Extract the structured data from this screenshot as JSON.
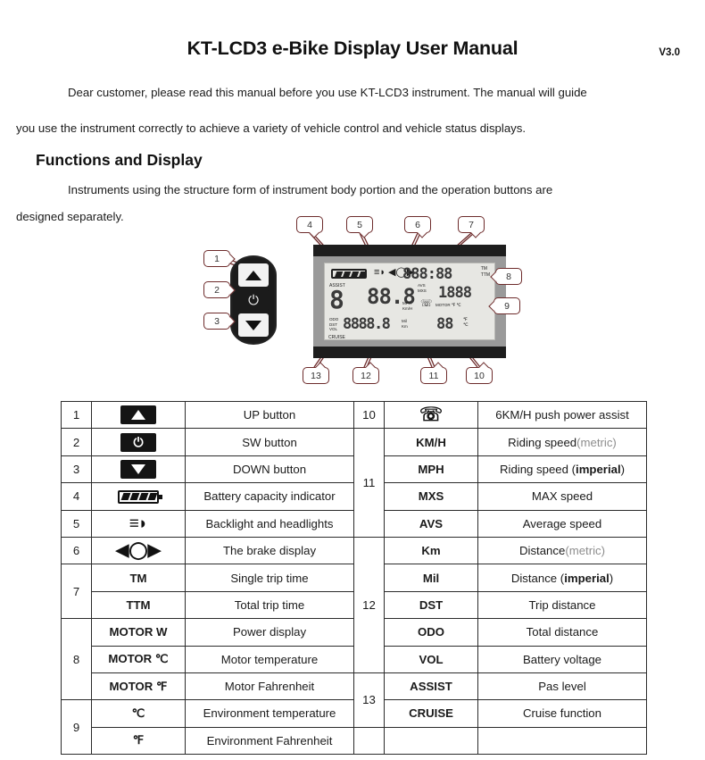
{
  "document": {
    "title": "KT-LCD3 e-Bike Display User Manual",
    "version": "V3.0",
    "intro_paragraph_1": "Dear customer, please read this manual before you use KT-LCD3 instrument. The manual will guide",
    "intro_paragraph_2": "you use the instrument correctly to achieve a variety of vehicle control and vehicle status displays.",
    "section_heading": "Functions and Display",
    "section_paragraph_1": "Instruments using the structure form of instrument body portion and the operation buttons are",
    "section_paragraph_2": "designed separately."
  },
  "diagram": {
    "callouts": [
      "1",
      "2",
      "3",
      "4",
      "5",
      "6",
      "7",
      "8",
      "9",
      "10",
      "11",
      "12",
      "13"
    ],
    "keypad": {
      "up_icon": "triangle-up-icon",
      "power_icon": "power-icon",
      "power_glyph": "⏻",
      "down_icon": "triangle-down-icon"
    },
    "lcd": {
      "battery_icon": "battery-icon",
      "headlight_glyph": "≡◗",
      "brake_glyph": "◀◯▶",
      "clock_value": "888:88",
      "tm_label": "TM",
      "ttm_label": "TTM",
      "assist_label": "ASSIST",
      "assist_value": "8",
      "cruise_label": "CRUISE",
      "speed_value": "88.8",
      "speed_unit_1": "MPH",
      "speed_unit_2": "Km/H",
      "avs_label": "AVS",
      "mxs_label": "MXS",
      "walk_glyph": "Ὣ6",
      "motor_value": "1888",
      "motor_label": "MOTOR ℉ ℃",
      "odo_label_1": "ODO",
      "odo_label_2": "DST",
      "odo_label_3": "VOL",
      "dst_value": "8888.8",
      "dst_unit_1": "Mil",
      "dst_unit_2": "Km",
      "temp_value": "88",
      "temp_unit_1": "℉",
      "temp_unit_2": "℃"
    }
  },
  "legend_table": {
    "left_rows": [
      {
        "num": "1",
        "sym_type": "icon",
        "sym_icon": "up-button-icon",
        "sym": "",
        "desc": "UP button"
      },
      {
        "num": "2",
        "sym_type": "icon",
        "sym_icon": "sw-button-icon",
        "sym": "",
        "desc": "SW button"
      },
      {
        "num": "3",
        "sym_type": "icon",
        "sym_icon": "down-button-icon",
        "sym": "",
        "desc": "DOWN button"
      },
      {
        "num": "4",
        "sym_type": "icon",
        "sym_icon": "battery-icon",
        "sym": "",
        "desc": "Battery capacity indicator"
      },
      {
        "num": "5",
        "sym_type": "icon",
        "sym_icon": "headlight-icon",
        "sym": "",
        "desc": "Backlight and headlights"
      },
      {
        "num": "6",
        "sym_type": "icon",
        "sym_icon": "brake-icon",
        "sym": "",
        "desc": "The brake display"
      },
      {
        "num": "7",
        "sym_type": "text",
        "sym_icon": "",
        "sym": "TM",
        "desc": "Single trip time",
        "rowspan": 2
      },
      {
        "num": "",
        "sym_type": "text",
        "sym_icon": "",
        "sym": "TTM",
        "desc": "Total trip time"
      },
      {
        "num": "8",
        "sym_type": "text",
        "sym_icon": "",
        "sym": "MOTOR W",
        "desc": "Power display",
        "rowspan": 3
      },
      {
        "num": "",
        "sym_type": "text",
        "sym_icon": "",
        "sym": "MOTOR ℃",
        "desc": "Motor temperature"
      },
      {
        "num": "",
        "sym_type": "text",
        "sym_icon": "",
        "sym": "MOTOR ℉",
        "desc": "Motor Fahrenheit"
      },
      {
        "num": "9",
        "sym_type": "text",
        "sym_icon": "",
        "sym": "℃",
        "desc": "Environment temperature",
        "rowspan": 2
      },
      {
        "num": "",
        "sym_type": "text",
        "sym_icon": "",
        "sym": "℉",
        "desc": "Environment Fahrenheit"
      }
    ],
    "right_rows": [
      {
        "num": "10",
        "sym_type": "icon",
        "sym_icon": "walking-person-icon",
        "sym": "",
        "desc": "6KM/H push power assist"
      },
      {
        "num": "11",
        "sym_type": "text",
        "sym_icon": "",
        "sym": "KM/H",
        "desc_html": "Riding speed<span class='grey'>(metric)</span>",
        "rowspan": 4
      },
      {
        "num": "",
        "sym_type": "text",
        "sym_icon": "",
        "sym": "MPH",
        "desc_html": "Riding speed (<span class='bold'>imperial</span>)"
      },
      {
        "num": "",
        "sym_type": "text",
        "sym_icon": "",
        "sym": "MXS",
        "desc_html": "MAX speed"
      },
      {
        "num": "",
        "sym_type": "text",
        "sym_icon": "",
        "sym": "AVS",
        "desc_html": "Average speed"
      },
      {
        "num": "12",
        "sym_type": "text",
        "sym_icon": "",
        "sym": "Km",
        "desc_html": "Distance<span class='grey'>(metric)</span>",
        "rowspan": 5
      },
      {
        "num": "",
        "sym_type": "text",
        "sym_icon": "",
        "sym": "Mil",
        "desc_html": "Distance (<span class='bold'>imperial</span>)"
      },
      {
        "num": "",
        "sym_type": "text",
        "sym_icon": "",
        "sym": "DST",
        "desc_html": "Trip distance"
      },
      {
        "num": "",
        "sym_type": "text",
        "sym_icon": "",
        "sym": "ODO",
        "desc_html": "Total distance"
      },
      {
        "num": "",
        "sym_type": "text",
        "sym_icon": "",
        "sym": "VOL",
        "desc_html": "Battery voltage"
      },
      {
        "num": "13",
        "sym_type": "text",
        "sym_icon": "",
        "sym": "ASSIST",
        "desc_html": "Pas level",
        "rowspan": 2
      },
      {
        "num": "",
        "sym_type": "text",
        "sym_icon": "",
        "sym": "CRUISE",
        "desc_html": "Cruise function"
      },
      {
        "num": "",
        "sym_type": "empty",
        "sym_icon": "",
        "sym": "",
        "desc_html": ""
      }
    ]
  },
  "colors": {
    "callout_border": "#6d2b2b",
    "leader_line": "#6d2b2b",
    "table_border": "#2b2b2b",
    "text": "#1a1a1a",
    "muted_text": "#8d8d8d"
  }
}
